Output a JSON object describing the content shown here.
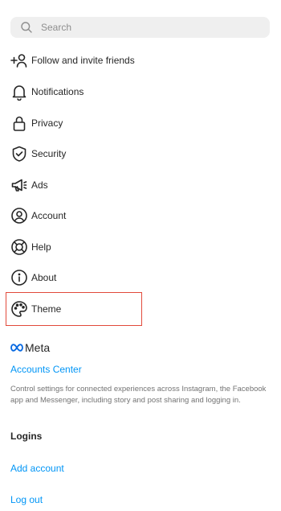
{
  "search": {
    "placeholder": "Search",
    "icon": "search-icon"
  },
  "menu": [
    {
      "label": "Follow and invite friends",
      "icon": "add-person-icon"
    },
    {
      "label": "Notifications",
      "icon": "bell-icon"
    },
    {
      "label": "Privacy",
      "icon": "lock-icon"
    },
    {
      "label": "Security",
      "icon": "shield-check-icon"
    },
    {
      "label": "Ads",
      "icon": "megaphone-icon"
    },
    {
      "label": "Account",
      "icon": "account-circle-icon"
    },
    {
      "label": "Help",
      "icon": "lifebuoy-icon"
    },
    {
      "label": "About",
      "icon": "info-icon"
    },
    {
      "label": "Theme",
      "icon": "palette-icon"
    }
  ],
  "meta": {
    "brand": "Meta",
    "accounts_center": "Accounts Center",
    "description": "Control settings for connected experiences across Instagram, the Facebook app and Messenger, including story and post sharing and logging in."
  },
  "logins": {
    "title": "Logins",
    "add_account": "Add account",
    "log_out": "Log out"
  },
  "colors": {
    "link": "#0095f6",
    "highlight": "#e24a3b",
    "search_bg": "#efefef"
  }
}
